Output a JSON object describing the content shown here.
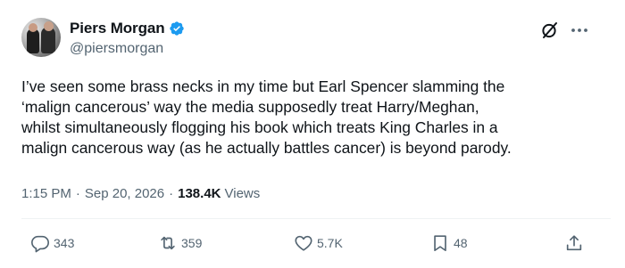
{
  "author": {
    "display_name": "Piers Morgan",
    "handle": "@piersmorgan",
    "verified": true,
    "verified_color": "#1d9bf0"
  },
  "tweet": {
    "lines": [
      "I’ve seen some brass necks in my time but Earl Spencer slamming the",
      "‘malign cancerous’ way the media supposedly treat Harry/Meghan,",
      "whilst simultaneously flogging his book which treats King Charles in a",
      "malign cancerous way (as he actually battles cancer) is beyond parody."
    ]
  },
  "meta": {
    "time": "1:15 PM",
    "separator": "·",
    "date": "Sep 20, 2026",
    "views_count": "138.4K",
    "views_label": "Views"
  },
  "actions": {
    "replies": "343",
    "reposts": "359",
    "likes": "5.7K",
    "bookmarks": "48"
  },
  "icons": {
    "avatar": "profile-photo",
    "verified": "verified-badge-icon",
    "grok": "grok-icon",
    "more": "more-icon",
    "reply": "reply-icon",
    "repost": "repost-icon",
    "like": "heart-icon",
    "bookmark": "bookmark-icon",
    "share": "share-icon"
  },
  "colors": {
    "text": "#0f1419",
    "secondary": "#536471",
    "divider": "#eff3f4"
  }
}
